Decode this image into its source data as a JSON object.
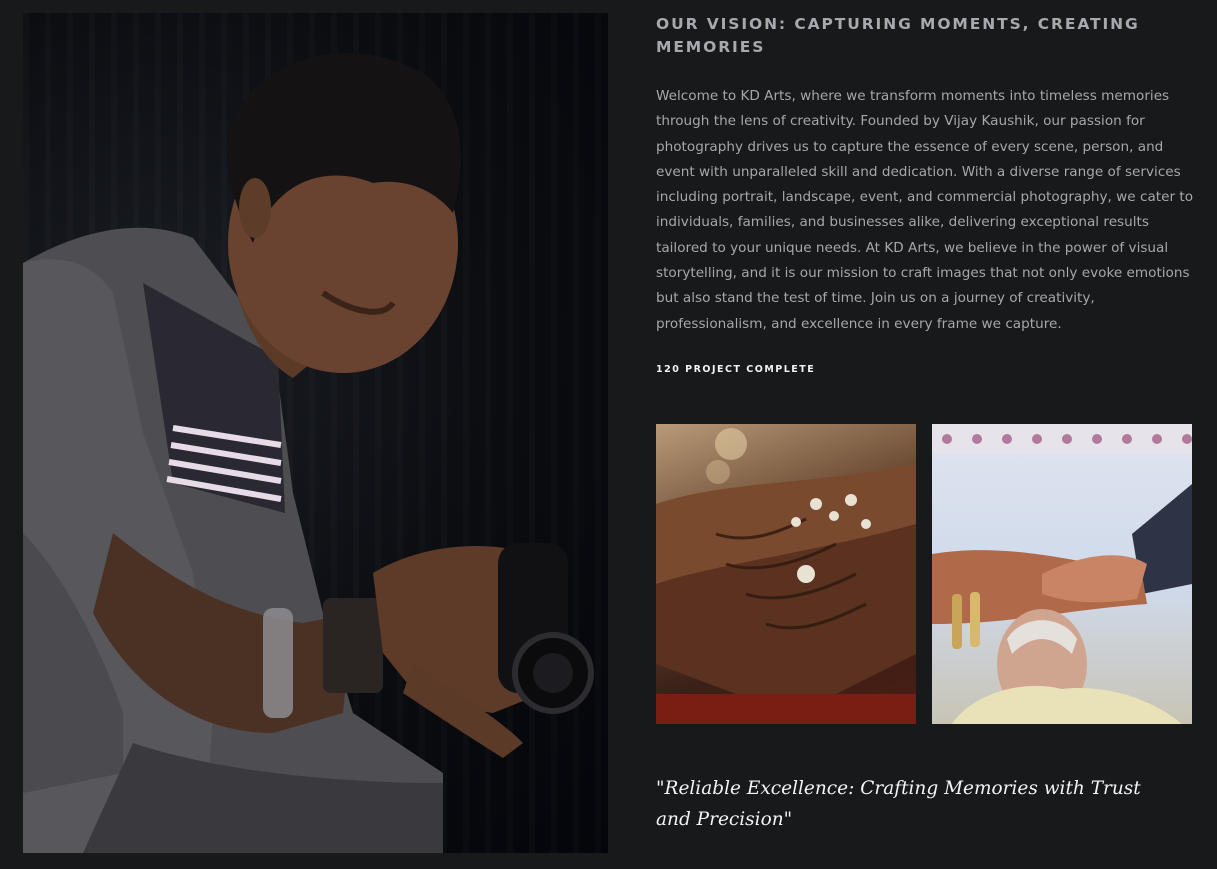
{
  "vision": {
    "heading": "OUR VISION: CAPTURING MOMENTS, CREATING MEMORIES",
    "body": "Welcome to KD Arts, where we transform moments into timeless memories through the lens of creativity. Founded by Vijay Kaushik, our passion for photography drives us to capture the essence of every scene, person, and event with unparalleled skill and dedication. With a diverse range of services including portrait, landscape, event, and commercial photography, we cater to individuals, families, and businesses alike, delivering exceptional results tailored to your unique needs. At KD Arts, we believe in the power of visual storytelling, and it is our mission to craft images that not only evoke emotions but also stand the test of time. Join us on a journey of creativity, professionalism, and excellence in every frame we capture.",
    "stat": "120 PROJECT COMPLETE"
  },
  "images": {
    "portrait": "photographer-portrait",
    "thumb_1": "mehndi-hands-photo",
    "thumb_2": "ring-ceremony-photo"
  },
  "tagline": "\"Reliable Excellence: Crafting Memories with Trust and Precision\"",
  "colors": {
    "background": "#17191b",
    "heading": "#a6a9ad",
    "body_text": "#a5a8ab",
    "accent_text": "#f2f2f2"
  }
}
